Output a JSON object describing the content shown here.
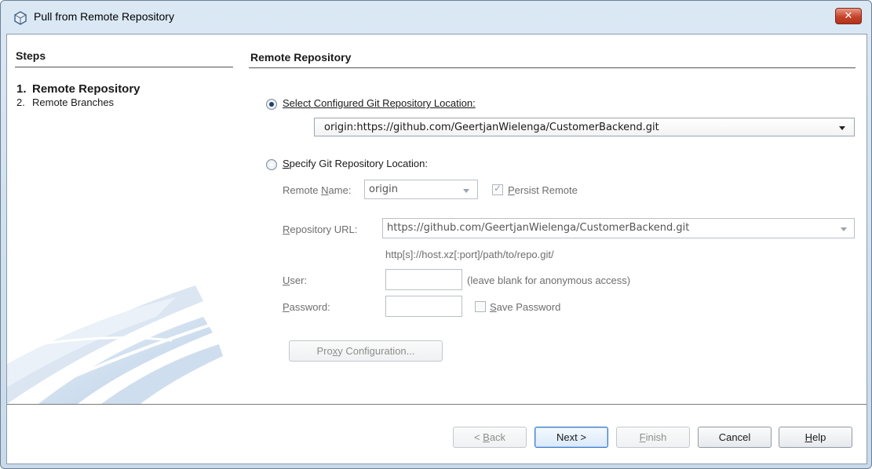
{
  "window": {
    "title": "Pull from Remote Repository",
    "close_glyph": "✕"
  },
  "steps": {
    "title": "Steps",
    "items": [
      {
        "num": "1.",
        "label": "Remote Repository",
        "active": true
      },
      {
        "num": "2.",
        "label": "Remote Branches",
        "active": false
      }
    ]
  },
  "main": {
    "title": "Remote Repository",
    "option_configured": {
      "label_prefix": "Select ",
      "label_mnemonic": "C",
      "label_rest": "onfigured Git Repository Location:",
      "selected": true,
      "value": "origin:https://github.com/GeertjanWielenga/CustomerBackend.git"
    },
    "option_specify": {
      "label_mnemonic": "S",
      "label_rest": "pecify Git Repository Location:",
      "selected": false
    },
    "remote_name": {
      "label_prefix": "Remote ",
      "label_mnemonic": "N",
      "label_rest": "ame:",
      "value": "origin"
    },
    "persist_remote": {
      "label_mnemonic": "P",
      "label_rest": "ersist Remote",
      "checked": true
    },
    "repository_url": {
      "label_mnemonic": "R",
      "label_rest": "epository URL:",
      "value": "https://github.com/GeertjanWielenga/CustomerBackend.git",
      "hint": "http[s]://host.xz[:port]/path/to/repo.git/"
    },
    "user": {
      "label_mnemonic": "U",
      "label_rest": "ser:",
      "value": "",
      "hint": "(leave blank for anonymous access)"
    },
    "password": {
      "label_mnemonic": "P",
      "label_rest": "assword:",
      "value": ""
    },
    "save_password": {
      "label_mnemonic": "S",
      "label_rest": "ave Password",
      "checked": false
    },
    "proxy_button": {
      "prefix": "Pro",
      "mnemonic": "x",
      "rest": "y Configuration..."
    }
  },
  "buttons": {
    "back": {
      "prefix": "< ",
      "mnemonic": "B",
      "rest": "ack",
      "enabled": false
    },
    "next": {
      "label": "Next >",
      "enabled": true
    },
    "finish": {
      "mnemonic": "F",
      "rest": "inish",
      "enabled": false
    },
    "cancel": {
      "label": "Cancel",
      "enabled": true
    },
    "help": {
      "mnemonic": "H",
      "rest": "elp",
      "enabled": true
    }
  },
  "colors": {
    "title_bar": "#dbe8f4",
    "close_button": "#c6432a",
    "default_button_border": "#3d78c6"
  },
  "icons": {
    "app": "netbeans-cube-icon",
    "close": "close-icon",
    "dropdown": "chevron-down-icon"
  }
}
